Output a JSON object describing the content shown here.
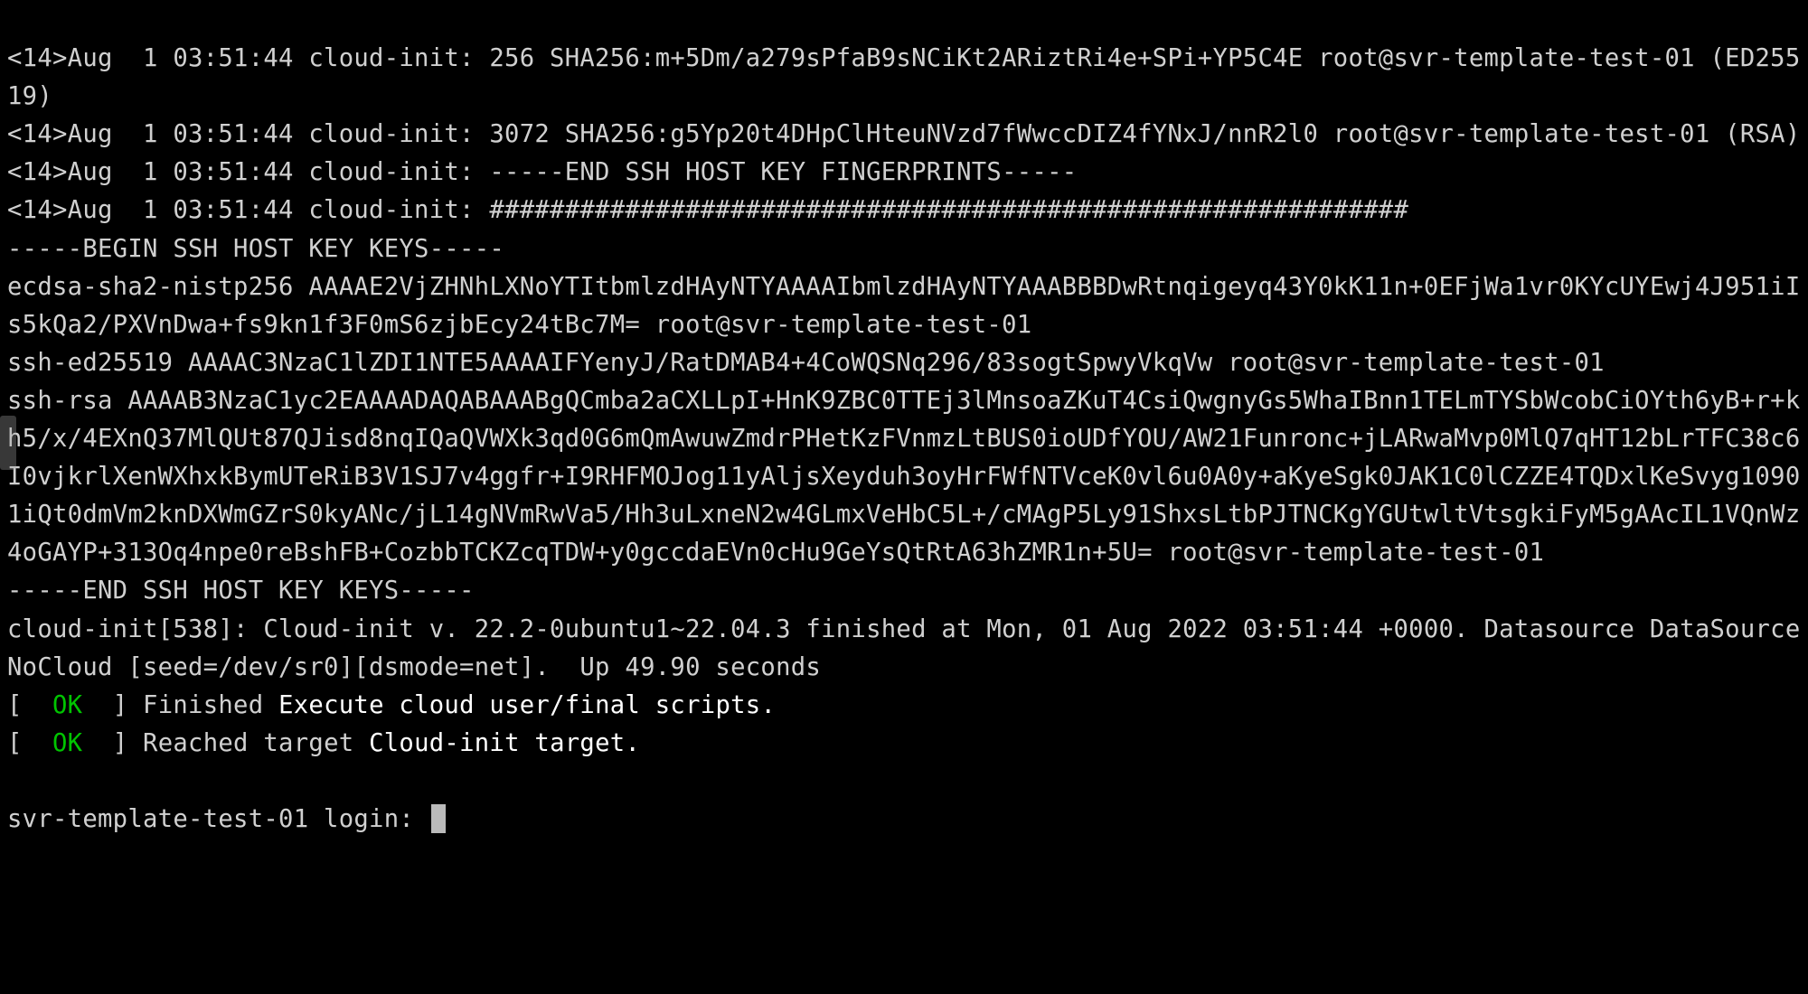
{
  "lines": {
    "l01": "<14>Aug  1 03:51:44 cloud-init: 256 SHA256:m+5Dm/a279sPfaB9sNCiKt2ARiztRi4e+SPi+YP5C4E root@svr-template-test-01 (ED25519)",
    "l02": "<14>Aug  1 03:51:44 cloud-init: 3072 SHA256:g5Yp20t4DHpClHteuNVzd7fWwccDIZ4fYNxJ/nnR2l0 root@svr-template-test-01 (RSA)",
    "l03": "<14>Aug  1 03:51:44 cloud-init: -----END SSH HOST KEY FINGERPRINTS-----",
    "l04": "<14>Aug  1 03:51:44 cloud-init: #############################################################",
    "l05": "-----BEGIN SSH HOST KEY KEYS-----",
    "l06": "ecdsa-sha2-nistp256 AAAAE2VjZHNhLXNoYTItbmlzdHAyNTYAAAAIbmlzdHAyNTYAAABBBDwRtnqigeyq43Y0kK11n+0EFjWa1vr0KYcUYEwj4J951iIs5kQa2/PXVnDwa+fs9kn1f3F0mS6zjbEcy24tBc7M= root@svr-template-test-01",
    "l07": "ssh-ed25519 AAAAC3NzaC1lZDI1NTE5AAAAIFYenyJ/RatDMAB4+4CoWQSNq296/83sogtSpwyVkqVw root@svr-template-test-01",
    "l08": "ssh-rsa AAAAB3NzaC1yc2EAAAADAQABAAABgQCmba2aCXLLpI+HnK9ZBC0TTEj3lMnsoaZKuT4CsiQwgnyGs5WhaIBnn1TELmTYSbWcobCiOYth6yB+r+kh5/x/4EXnQ37MlQUt87QJisd8nqIQaQVWXk3qd0G6mQmAwuwZmdrPHetKzFVnmzLtBUS0ioUDfYOU/AW21Funronc+jLARwaMvp0MlQ7qHT12bLrTFC38c6I0vjkrlXenWXhxkBymUTeRiB3V1SJ7v4ggfr+I9RHFMOJog11yAljsXeyduh3oyHrFWfNTVceK0vl6u0A0y+aKyeSgk0JAK1C0lCZZE4TQDxlKeSvyg10901iQt0dmVm2knDXWmGZrS0kyANc/jL14gNVmRwVa5/Hh3uLxneN2w4GLmxVeHbC5L+/cMAgP5Ly91ShxsLtbPJTNCKgYGUtwltVtsgkiFyM5gAAcIL1VQnWz4oGAYP+313Oq4npe0reBshFB+CozbbTCKZcqTDW+y0gccdaEVn0cHu9GeYsQtRtA63hZMR1n+5U= root@svr-template-test-01",
    "l09": "-----END SSH HOST KEY KEYS-----",
    "l10": "cloud-init[538]: Cloud-init v. 22.2-0ubuntu1~22.04.3 finished at Mon, 01 Aug 2022 03:51:44 +0000. Datasource DataSourceNoCloud [seed=/dev/sr0][dsmode=net].  Up 49.90 seconds"
  },
  "status": {
    "ok": "OK",
    "finished_pre": "Finished ",
    "finished_white": "Execute cloud user/final scripts.",
    "reached_pre": "Reached target ",
    "reached_white": "Cloud-init target."
  },
  "prompt": "svr-template-test-01 login: "
}
